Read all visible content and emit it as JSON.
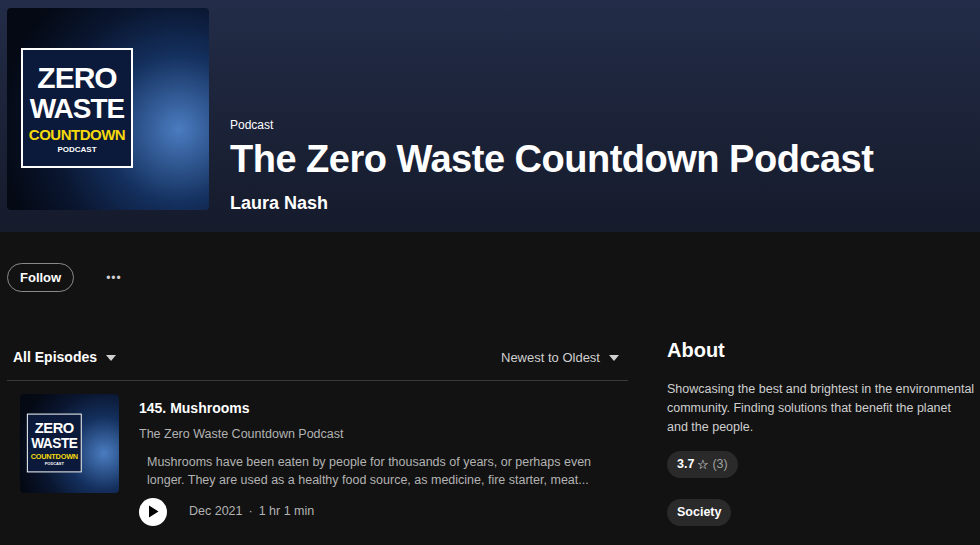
{
  "header": {
    "type": "Podcast",
    "title": "The Zero Waste Countdown Podcast",
    "author": "Laura Nash"
  },
  "cover": {
    "lines": [
      "ZERO",
      "WASTE",
      "COUNTDOWN",
      "PODCAST"
    ]
  },
  "actions": {
    "follow": "Follow",
    "more": "•••"
  },
  "episodes_filter": {
    "label": "All Episodes",
    "sort": "Newest to Oldest"
  },
  "episodes": [
    {
      "title": "145. Mushrooms",
      "show": "The Zero Waste Countdown Podcast",
      "description": "Mushrooms have been eaten by people for thousands of years, or perhaps even longer. They are used as a healthy food source, as medicine, fire starter, meat...",
      "date": "Dec 2021",
      "separator": "·",
      "duration": "1 hr 1 min"
    }
  ],
  "about": {
    "heading": "About",
    "description": "Showcasing the best and brightest in the environmental community. Finding solutions that benefit the planet and the people.",
    "rating": "3.7",
    "rating_icon": "☆",
    "rating_count": "(3)",
    "category": "Society"
  }
}
